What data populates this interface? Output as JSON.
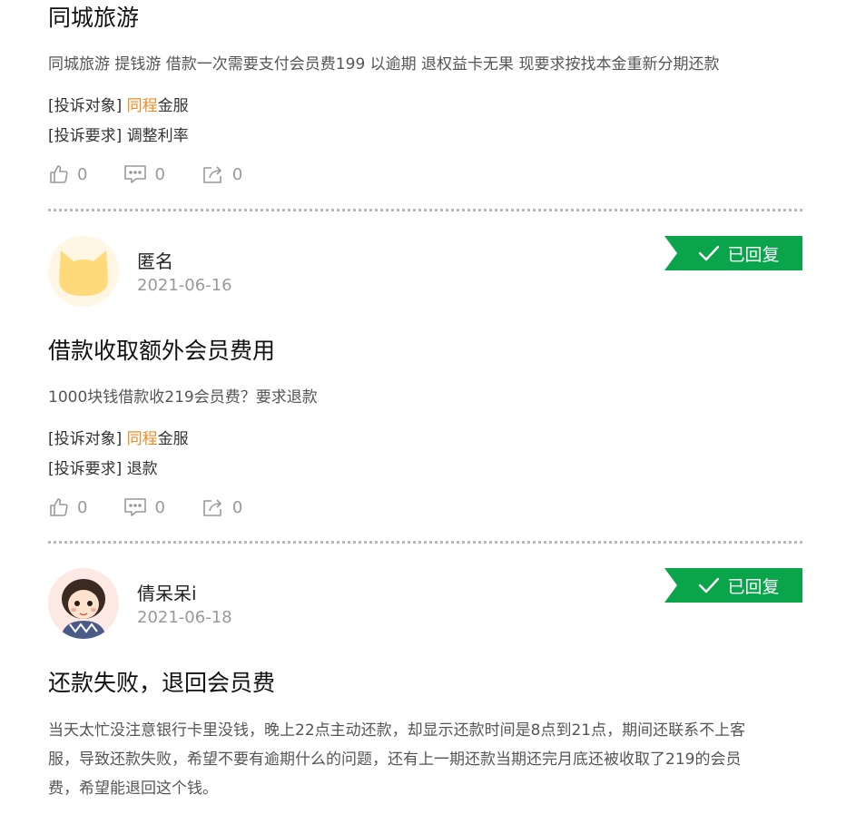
{
  "posts": [
    {
      "title": "同城旅游",
      "description": "同城旅游 提钱游 借款一次需要支付会员费199 以逾期 退权益卡无果 现要求按找本金重新分期还款",
      "target_label": "[投诉对象]",
      "target_highlight": "同程",
      "target_rest": "金服",
      "demand_label": "[投诉要求]",
      "demand_value": "调整利率",
      "likes": "0",
      "comments": "0",
      "shares": "0"
    },
    {
      "user": "匿名",
      "date": "2021-06-16",
      "status": "已回复",
      "title": "借款收取额外会员费用",
      "description": "1000块钱借款收219会员费？要求退款",
      "target_label": "[投诉对象]",
      "target_highlight": "同程",
      "target_rest": "金服",
      "demand_label": "[投诉要求]",
      "demand_value": "退款",
      "likes": "0",
      "comments": "0",
      "shares": "0"
    },
    {
      "user": "倩呆呆i",
      "date": "2021-06-18",
      "status": "已回复",
      "title": "还款失败，退回会员费",
      "description_lines": [
        "当天太忙没注意银行卡里没钱，晚上22点主动还款，却显示还款时间是8点到21点，期间还联系不上客",
        "服，导致还款失败，希望不要有逾期什么的问题，还有上一期还款当期还完月底还被收取了219的会员",
        "费，希望能退回这个钱。"
      ]
    }
  ],
  "colors": {
    "accent_orange": "#f08a24",
    "replied_green": "#0aa44b",
    "muted_gray": "#999999"
  },
  "icons": [
    "thumb-up-icon",
    "comment-icon",
    "share-icon",
    "check-icon"
  ]
}
